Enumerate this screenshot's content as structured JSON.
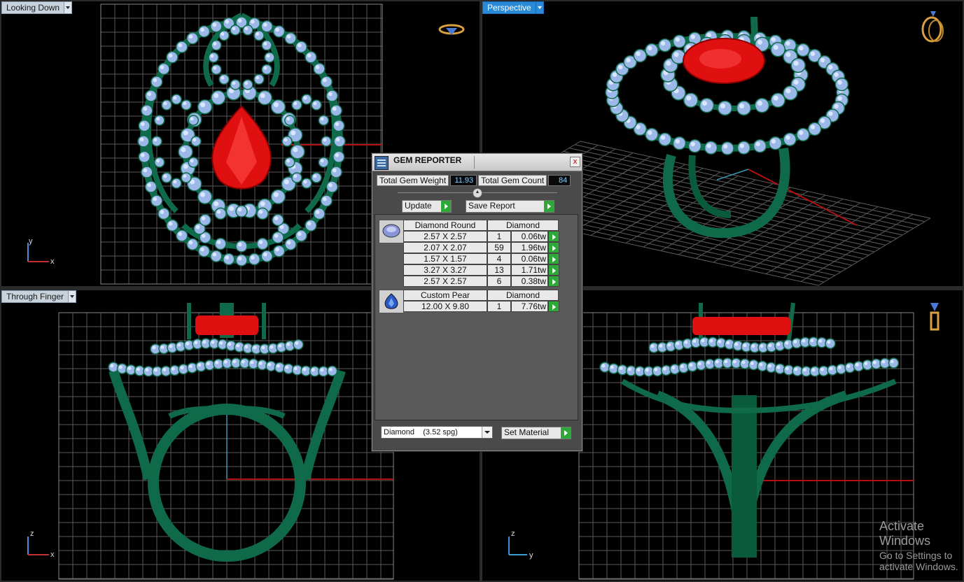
{
  "viewports": {
    "top_left": {
      "label": "Looking Down",
      "axis_v": "y",
      "axis_h": "x"
    },
    "top_right": {
      "label": "Perspective"
    },
    "bottom_left": {
      "label": "Through Finger",
      "axis_v": "z",
      "axis_h": "x"
    },
    "bottom_right": {
      "label": "",
      "axis_v": "z",
      "axis_h": "y"
    }
  },
  "gem_reporter": {
    "title": "GEM REPORTER",
    "close": "x",
    "total_weight_label": "Total Gem Weight",
    "total_weight": "11.93",
    "total_count_label": "Total Gem Count",
    "total_count": "84",
    "update_label": "Update",
    "save_report_label": "Save Report",
    "groups": [
      {
        "name": "Diamond Round",
        "material": "Diamond",
        "icon": "round-diamond-icon",
        "rows": [
          {
            "size": "2.57 X 2.57",
            "count": "1",
            "tw": "0.06tw"
          },
          {
            "size": "2.07 X 2.07",
            "count": "59",
            "tw": "1.96tw"
          },
          {
            "size": "1.57 X 1.57",
            "count": "4",
            "tw": "0.06tw"
          },
          {
            "size": "3.27 X 3.27",
            "count": "13",
            "tw": "1.71tw"
          },
          {
            "size": "2.57 X 2.57",
            "count": "6",
            "tw": "0.38tw"
          }
        ]
      },
      {
        "name": "Custom Pear",
        "material": "Diamond",
        "icon": "pear-gem-icon",
        "rows": [
          {
            "size": "12.00 X 9.80",
            "count": "1",
            "tw": "7.76tw"
          }
        ]
      }
    ],
    "material_select": "Diamond    (3.52 spg)",
    "set_material_label": "Set Material"
  },
  "watermark": {
    "line1": "Activate Windows",
    "line2": "Go to Settings to activate Windows."
  },
  "colors": {
    "ring_metal": "#0f6a4a",
    "gem_blue": "#9bb8e8",
    "center_stone": "#e01010",
    "grid": "#666666",
    "active_tab": "#2a8ad8"
  }
}
